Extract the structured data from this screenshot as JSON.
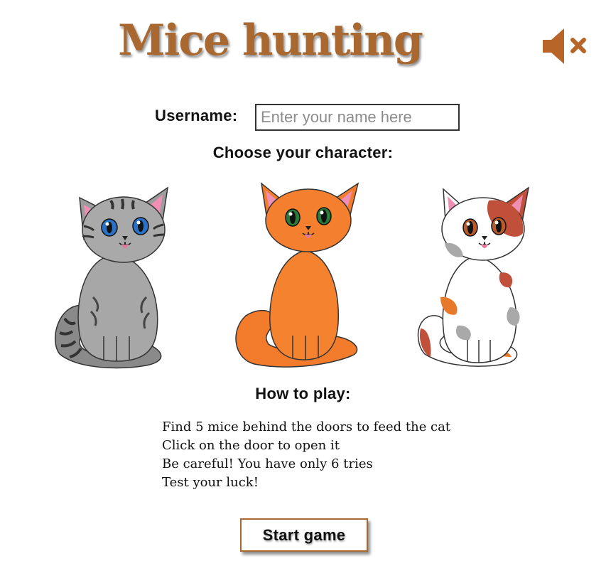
{
  "header": {
    "title": "Mice hunting",
    "mute_icon": "speaker-muted-icon"
  },
  "form": {
    "username_label": "Username:",
    "username_value": "",
    "username_placeholder": "Enter your name here"
  },
  "character": {
    "heading": "Choose your character:",
    "options": [
      {
        "name": "grey-tabby-cat",
        "body_color": "#9e9e9e"
      },
      {
        "name": "orange-cat",
        "body_color": "#f27a2c"
      },
      {
        "name": "calico-cat",
        "body_color": "#ffffff"
      }
    ]
  },
  "how_to_play": {
    "heading": "How to play:",
    "lines": [
      "Find 5 mice behind the doors to feed the cat",
      "Click on the door to open it",
      "Be careful! You have only 6 tries",
      "Test your luck!"
    ]
  },
  "start_button": "Start game",
  "colors": {
    "accent": "#a8682f"
  }
}
